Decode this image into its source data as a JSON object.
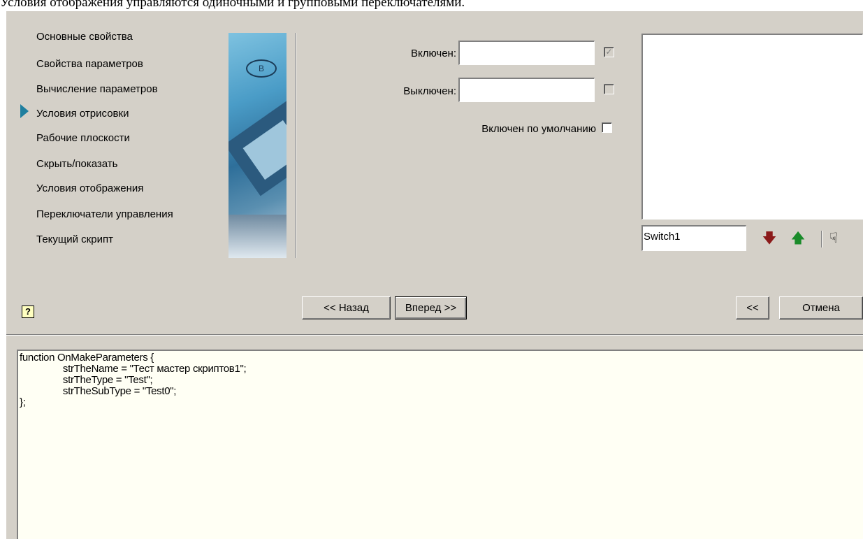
{
  "caption": "Условия отображения управляются одиночными и групповыми переключателями.",
  "nav": {
    "items": [
      {
        "label": "Основные свойства"
      },
      {
        "label": "Свойства параметров"
      },
      {
        "label": "Вычисление параметров"
      },
      {
        "label": "Условия отрисовки"
      },
      {
        "label": "Рабочие плоскости"
      },
      {
        "label": "Скрыть/показать"
      },
      {
        "label": "Условия отображения"
      },
      {
        "label": "Переключатели управления"
      },
      {
        "label": "Текущий скрипт"
      }
    ],
    "active_index": 3,
    "art_badge": "B"
  },
  "form": {
    "on_label": "Включен:",
    "on_value": "",
    "on_checkbox": "✓",
    "off_label": "Выключен:",
    "off_value": "",
    "default_label": "Включен по умолчанию"
  },
  "switch": {
    "value": "Switch1",
    "down_icon": "🡇",
    "up_icon": "🡅",
    "hand_icon": "☟"
  },
  "buttons": {
    "help": "?",
    "back": "<< Назад",
    "next": "Вперед >>",
    "collapse": "<<",
    "cancel": "Отмена"
  },
  "code": {
    "text": "function OnMakeParameters {\n\t\tstrTheName = \"Тест мастер скриптов1\";\n\t\tstrTheType = \"Test\";\n\t\tstrTheSubType = \"Test0\";\n};"
  },
  "colors": {
    "dialog_bg": "#d4d0c8",
    "arrow": "#1f7f9f",
    "down_arrow": "#8b1a1a",
    "up_arrow": "#1a8b2a",
    "code_bg": "#fffff4"
  }
}
